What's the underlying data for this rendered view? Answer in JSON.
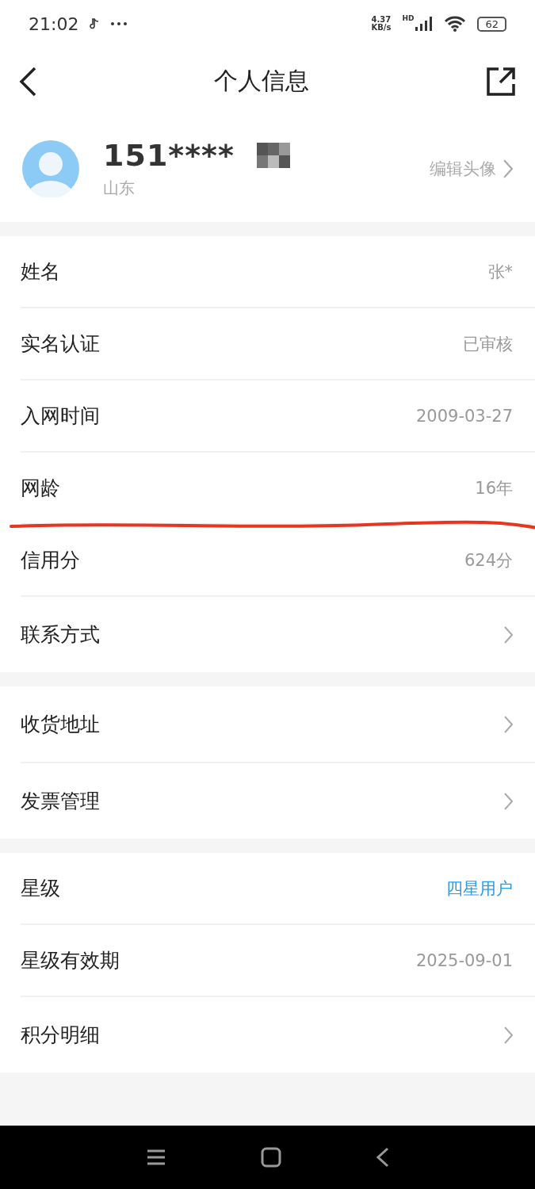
{
  "status_bar": {
    "time": "21:02",
    "speed": "4.37",
    "speed_unit": "KB/s",
    "network": "HD",
    "battery": "62"
  },
  "header": {
    "title": "个人信息"
  },
  "profile": {
    "phone": "151****",
    "region": "山东",
    "edit_label": "编辑头像"
  },
  "groups": [
    {
      "rows": [
        {
          "label": "姓名",
          "kind": "text",
          "value": "张*",
          "underlined": false
        },
        {
          "label": "实名认证",
          "kind": "text",
          "value": "已审核",
          "underlined": false
        },
        {
          "label": "入网时间",
          "kind": "text",
          "value": "2009-03-27",
          "underlined": false
        },
        {
          "label": "网龄",
          "kind": "text",
          "value": "16年",
          "underlined": true
        },
        {
          "label": "信用分",
          "kind": "text",
          "value": "624分",
          "underlined": false
        },
        {
          "label": "联系方式",
          "kind": "link",
          "underlined": false
        }
      ]
    },
    {
      "rows": [
        {
          "label": "收货地址",
          "kind": "link",
          "underlined": false
        },
        {
          "label": "发票管理",
          "kind": "link",
          "underlined": false
        }
      ]
    },
    {
      "rows": [
        {
          "label": "星级",
          "kind": "accent",
          "value": "四星用户",
          "underlined": false
        },
        {
          "label": "星级有效期",
          "kind": "text",
          "value": "2025-09-01",
          "underlined": false
        },
        {
          "label": "积分明细",
          "kind": "link",
          "underlined": false
        }
      ]
    }
  ]
}
